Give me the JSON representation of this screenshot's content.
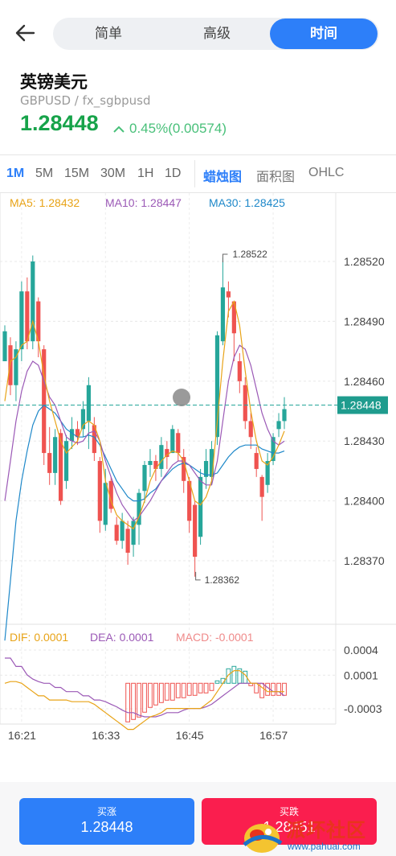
{
  "header": {
    "tabs": [
      {
        "label": "简单",
        "active": false
      },
      {
        "label": "高级",
        "active": false
      },
      {
        "label": "时间",
        "active": true
      }
    ]
  },
  "instrument": {
    "name": "英镑美元",
    "symbol": "GBPUSD / fx_sgbpusd",
    "price": "1.28448",
    "change": "0.45%(0.00574)"
  },
  "toolbar": {
    "timeframes": [
      "1M",
      "5M",
      "15M",
      "30M",
      "1H",
      "1D"
    ],
    "active_timeframe": "1M",
    "chart_types": [
      "蜡烛图",
      "面积图",
      "OHLC"
    ],
    "active_chart_type": "蜡烛图"
  },
  "indicators": {
    "ma5": "MA5: 1.28432",
    "ma10": "MA10: 1.28447",
    "ma30": "MA30: 1.28425",
    "dif": "DIF: 0.0001",
    "dea": "DEA: 0.0001",
    "macd": "MACD: -0.0001"
  },
  "chart_data": {
    "type": "candlestick",
    "price_ticks": [
      1.2852,
      1.2849,
      1.2846,
      1.2843,
      1.284,
      1.2837
    ],
    "price_tick_labels": [
      "1.28520",
      "1.28490",
      "1.28460",
      "1.28430",
      "1.28400",
      "1.28370"
    ],
    "current_price_label": "1.28448",
    "current_price": 1.28448,
    "max_label": "1.28522",
    "min_label": "1.28362",
    "max_value": 1.28522,
    "min_value": 1.28362,
    "macd_tick_labels": [
      "0.0004",
      "0.0001",
      "-0.0003"
    ],
    "macd_ticks": [
      0.0004,
      0.0001,
      -0.0003
    ],
    "time_labels": [
      "16:21",
      "16:33",
      "16:45",
      "16:57"
    ],
    "candles": [
      [
        1.2847,
        1.28485,
        1.28478,
        1.28488
      ],
      [
        1.28478,
        1.28458,
        1.28453,
        1.28482
      ],
      [
        1.28458,
        1.28476,
        1.2845,
        1.2848
      ],
      [
        1.28476,
        1.28505,
        1.2847,
        1.2851
      ],
      [
        1.28505,
        1.2848,
        1.28476,
        1.28512
      ],
      [
        1.2848,
        1.2852,
        1.28476,
        1.28523
      ],
      [
        1.285,
        1.2848,
        1.28472,
        1.28502
      ],
      [
        1.28476,
        1.28424,
        1.28418,
        1.28478
      ],
      [
        1.28424,
        1.28414,
        1.28408,
        1.28437
      ],
      [
        1.28414,
        1.28432,
        1.28408,
        1.28436
      ],
      [
        1.28434,
        1.284,
        1.28398,
        1.28436
      ],
      [
        1.2841,
        1.2843,
        1.28406,
        1.28433
      ],
      [
        1.2843,
        1.28436,
        1.28426,
        1.28442
      ],
      [
        1.28436,
        1.28432,
        1.28428,
        1.2844
      ],
      [
        1.28436,
        1.28446,
        1.28432,
        1.2845
      ],
      [
        1.2844,
        1.28458,
        1.28426,
        1.28462
      ],
      [
        1.28438,
        1.28424,
        1.2842,
        1.28442
      ],
      [
        1.2842,
        1.2839,
        1.28384,
        1.28422
      ],
      [
        1.28388,
        1.28409,
        1.28385,
        1.28416
      ],
      [
        1.2841,
        1.28396,
        1.28394,
        1.28412
      ],
      [
        1.28388,
        1.2838,
        1.28378,
        1.28392
      ],
      [
        1.2838,
        1.2839,
        1.28376,
        1.28394
      ],
      [
        1.28386,
        1.28374,
        1.28368,
        1.2839
      ],
      [
        1.28378,
        1.2839,
        1.28372,
        1.28392
      ],
      [
        1.28388,
        1.28404,
        1.28378,
        1.28406
      ],
      [
        1.28405,
        1.28418,
        1.28399,
        1.2842
      ],
      [
        1.28418,
        1.2842,
        1.28412,
        1.28426
      ],
      [
        1.2842,
        1.28416,
        1.2841,
        1.28423
      ],
      [
        1.28416,
        1.28428,
        1.28412,
        1.28432
      ],
      [
        1.28426,
        1.28422,
        1.28416,
        1.2843
      ],
      [
        1.28424,
        1.28436,
        1.28424,
        1.28438
      ],
      [
        1.28434,
        1.28424,
        1.2842,
        1.28436
      ],
      [
        1.28422,
        1.2841,
        1.28404,
        1.28426
      ],
      [
        1.2841,
        1.2839,
        1.28384,
        1.28412
      ],
      [
        1.28398,
        1.28372,
        1.28362,
        1.284
      ],
      [
        1.28382,
        1.28412,
        1.28378,
        1.28416
      ],
      [
        1.28412,
        1.2842,
        1.28406,
        1.28426
      ],
      [
        1.28412,
        1.28426,
        1.28408,
        1.2843
      ],
      [
        1.28432,
        1.28483,
        1.28428,
        1.28485
      ],
      [
        1.2848,
        1.28507,
        1.28478,
        1.28522
      ],
      [
        1.28505,
        1.28502,
        1.28492,
        1.2851
      ],
      [
        1.285,
        1.28484,
        1.2847,
        1.285
      ],
      [
        1.2847,
        1.2846,
        1.28454,
        1.28474
      ],
      [
        1.28458,
        1.2844,
        1.28436,
        1.28462
      ],
      [
        1.2844,
        1.28432,
        1.28426,
        1.28444
      ],
      [
        1.28424,
        1.28416,
        1.28412,
        1.28427
      ],
      [
        1.28412,
        1.28402,
        1.2839,
        1.28413
      ],
      [
        1.28408,
        1.2842,
        1.28404,
        1.28424
      ],
      [
        1.2842,
        1.28432,
        1.28418,
        1.28434
      ],
      [
        1.28436,
        1.2844,
        1.28432,
        1.28444
      ],
      [
        1.2844,
        1.28446,
        1.28436,
        1.28452
      ]
    ],
    "ma5": [
      1.2845,
      1.2847,
      1.28472,
      1.28478,
      1.2848,
      1.2849,
      1.2848,
      1.28463,
      1.2845,
      1.2844,
      1.2843,
      1.28424,
      1.28427,
      1.2843,
      1.28438,
      1.2844,
      1.28438,
      1.2843,
      1.2841,
      1.284,
      1.28393,
      1.2839,
      1.28388,
      1.28386,
      1.28392,
      1.284,
      1.2841,
      1.28416,
      1.2842,
      1.28423,
      1.28425,
      1.28424,
      1.2842,
      1.2841,
      1.284,
      1.28398,
      1.28402,
      1.2841,
      1.2844,
      1.2847,
      1.28495,
      1.285,
      1.28488,
      1.28465,
      1.28445,
      1.2843,
      1.2842,
      1.28418,
      1.28422,
      1.28428,
      1.28435
    ],
    "ma10": [
      1.284,
      1.2842,
      1.2844,
      1.28455,
      1.28465,
      1.2847,
      1.28468,
      1.2846,
      1.28452,
      1.28448,
      1.2844,
      1.28432,
      1.2843,
      1.28429,
      1.2843,
      1.28434,
      1.28435,
      1.2843,
      1.2842,
      1.28412,
      1.28404,
      1.28398,
      1.28394,
      1.2839,
      1.28392,
      1.28396,
      1.284,
      1.28405,
      1.2841,
      1.28414,
      1.28418,
      1.2842,
      1.2842,
      1.28418,
      1.28414,
      1.2841,
      1.28408,
      1.28408,
      1.2842,
      1.2844,
      1.2846,
      1.28472,
      1.28478,
      1.28476,
      1.28468,
      1.28456,
      1.28444,
      1.28436,
      1.2843,
      1.28428,
      1.2843
    ],
    "ma30": [
      1.2833,
      1.2836,
      1.2839,
      1.2841,
      1.28425,
      1.28438,
      1.28445,
      1.28448,
      1.28446,
      1.28444,
      1.2844,
      1.28436,
      1.28434,
      1.28432,
      1.28432,
      1.28433,
      1.28432,
      1.28428,
      1.28422,
      1.28416,
      1.2841,
      1.28406,
      1.28402,
      1.284,
      1.284,
      1.28401,
      1.28404,
      1.28406,
      1.2841,
      1.28413,
      1.28416,
      1.28418,
      1.28419,
      1.28418,
      1.28416,
      1.28414,
      1.28413,
      1.28413,
      1.28414,
      1.28418,
      1.28422,
      1.28425,
      1.28427,
      1.28428,
      1.28428,
      1.28428,
      1.28426,
      1.28425,
      1.28424,
      1.28424,
      1.28425
    ],
    "macd_hist": [
      0,
      0,
      0,
      0,
      0,
      0,
      0,
      0,
      0,
      0,
      0,
      0,
      0,
      0,
      0,
      0,
      0,
      0,
      0,
      0,
      0,
      0,
      -0.0008,
      -0.00075,
      -0.0007,
      -0.0006,
      -0.0005,
      -0.00045,
      -0.0004,
      -0.00035,
      -0.00035,
      -0.0003,
      -0.0003,
      -0.00025,
      -0.00025,
      -0.0002,
      -0.0002,
      -0.00015,
      5e-05,
      0.0001,
      0.0003,
      0.00035,
      0.0003,
      0.00025,
      -5e-05,
      -0.0002,
      -0.0003,
      -0.00025,
      -0.00025,
      -0.00025,
      -0.00025
    ],
    "dif": [
      0.0001,
      0.00012,
      0.00012,
      0.0001,
      5e-05,
      0,
      -5e-05,
      -5e-05,
      -0.0001,
      -0.0001,
      -0.0001,
      -0.0001,
      -0.00012,
      -0.00012,
      -0.00012,
      -0.00012,
      -0.00015,
      -0.0002,
      -0.00025,
      -0.0003,
      -0.00035,
      -0.0004,
      -0.00045,
      -0.00045,
      -0.0004,
      -0.00035,
      -0.0003,
      -0.00028,
      -0.00025,
      -0.0002,
      -0.0002,
      -0.0002,
      -0.0002,
      -0.0002,
      -0.0002,
      -0.0002,
      -0.00015,
      -0.0001,
      0,
      0.0001,
      0.0002,
      0.00025,
      0.00025,
      0.0002,
      0.0001,
      0.0001,
      5e-05,
      0,
      0,
      0,
      0
    ],
    "dea": [
      0.0004,
      0.0004,
      0.0003,
      0.0003,
      0.0002,
      0.00015,
      0.00012,
      0.0001,
      0.0001,
      5e-05,
      5e-05,
      0,
      0,
      0,
      -5e-05,
      -5e-05,
      -0.0001,
      -0.0001,
      -0.00012,
      -0.00015,
      -0.00018,
      -0.00022,
      -0.00025,
      -0.00025,
      -0.00028,
      -0.0003,
      -0.0003,
      -0.0003,
      -0.00028,
      -0.00025,
      -0.00025,
      -0.00025,
      -0.00022,
      -0.0002,
      -0.0002,
      -0.0002,
      -0.00018,
      -0.00015,
      -0.0001,
      -5e-05,
      0,
      5e-05,
      0.0001,
      0.0001,
      0.0001,
      0.0001,
      0.0001,
      5e-05,
      0,
      0,
      -5e-05
    ]
  },
  "colors": {
    "accent": "#2d7ff9",
    "up": "#26a69a",
    "down": "#ef5350",
    "price_green": "#17a34a",
    "ma5": "#e8a317",
    "ma10": "#9b59b6",
    "ma30": "#1e88c9",
    "sell": "#fa1e4e"
  },
  "actions": {
    "buy_label": "买涨",
    "buy_price": "1.28448",
    "sell_label": "买跌",
    "sell_price": "1.28451"
  },
  "watermark": {
    "text": "派坏社区",
    "url": "www.pahuai.com"
  }
}
